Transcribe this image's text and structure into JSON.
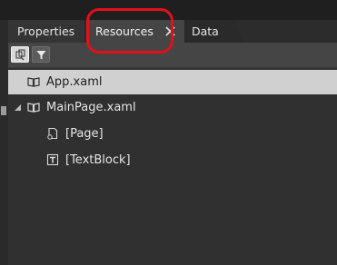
{
  "tabs": [
    {
      "label": "Properties",
      "active": false
    },
    {
      "label": "Resources",
      "active": true
    },
    {
      "label": "Data",
      "active": false
    }
  ],
  "toolbar": {
    "buttons": [
      {
        "icon": "scope-toggle-icon",
        "active": true
      },
      {
        "icon": "filter-icon",
        "active": false
      }
    ]
  },
  "tree": {
    "items": [
      {
        "label": "App.xaml",
        "icon": "open-book-icon",
        "level": 0,
        "selected": true,
        "expanded": null
      },
      {
        "label": "MainPage.xaml",
        "icon": "open-book-icon",
        "level": 0,
        "selected": false,
        "expanded": true
      },
      {
        "label": "[Page]",
        "icon": "page-element-icon",
        "level": 1,
        "selected": false,
        "expanded": null
      },
      {
        "label": "[TextBlock]",
        "icon": "textblock-icon",
        "level": 1,
        "selected": false,
        "expanded": null
      }
    ]
  },
  "colors": {
    "highlight": "#e3101a",
    "selected_row": "#d0d0d0",
    "active_tab": "#454545",
    "panel_background": "#303030"
  }
}
